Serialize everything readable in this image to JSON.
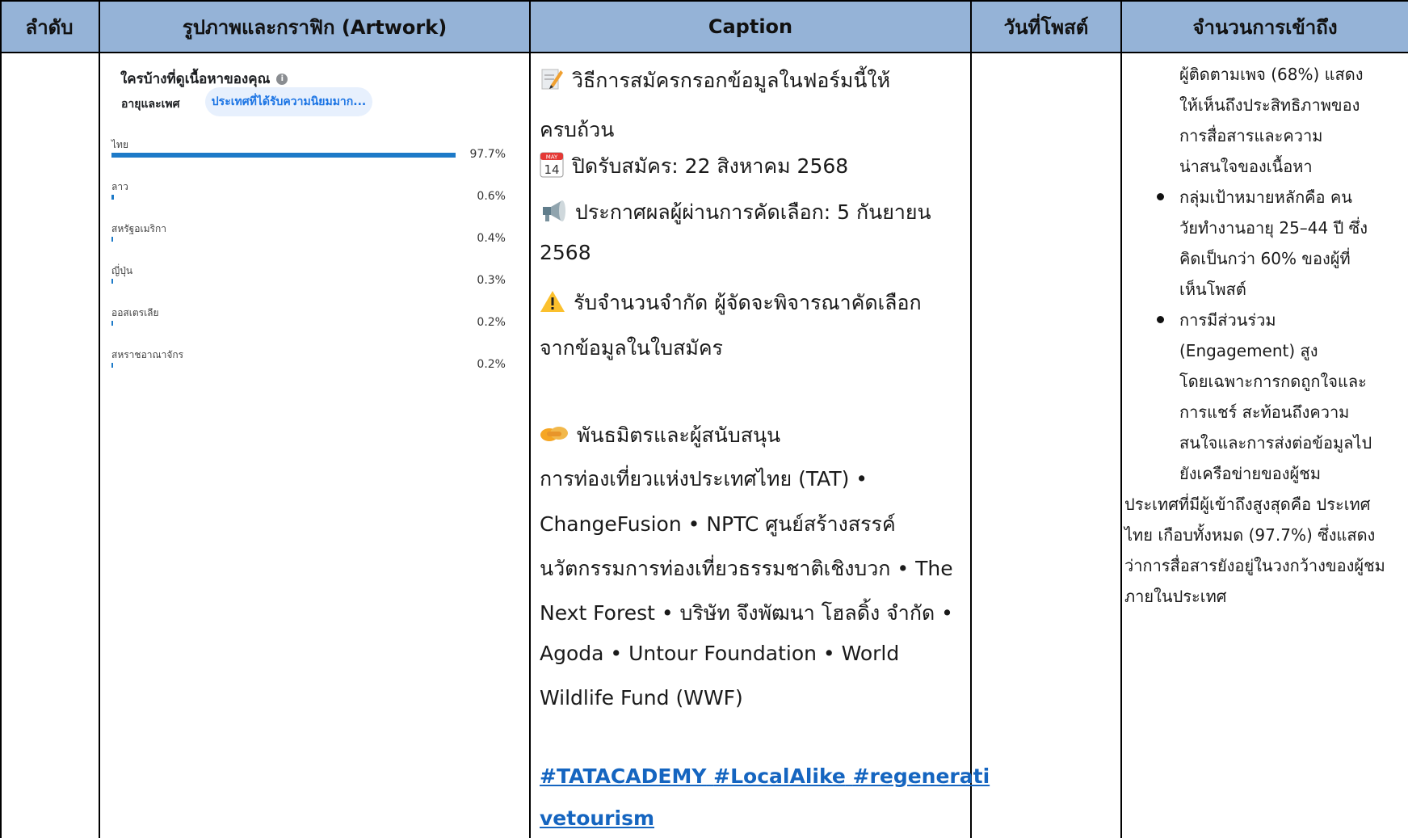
{
  "table": {
    "headers": {
      "no": "ลำดับ",
      "artwork": "รูปภาพและกราฟิก (Artwork)",
      "caption": "Caption",
      "date": "วันที่โพสต์",
      "reach": "จำนวนการเข้าถึง"
    }
  },
  "artwork": {
    "title": "ใครบ้างที่ดูเนื้อหาของคุณ",
    "tab_age": "อายุและเพศ",
    "tab_country": "ประเทศที่ได้รับความนิยมมาก...",
    "rows": [
      {
        "name": "ไทย",
        "pct": "97.7%",
        "value": 97.7
      },
      {
        "name": "ลาว",
        "pct": "0.6%",
        "value": 0.6
      },
      {
        "name": "สหรัฐอเมริกา",
        "pct": "0.4%",
        "value": 0.4
      },
      {
        "name": "ญี่ปุ่น",
        "pct": "0.3%",
        "value": 0.3
      },
      {
        "name": "ออสเตรเลีย",
        "pct": "0.2%",
        "value": 0.2
      },
      {
        "name": "สหราชอาณาจักร",
        "pct": "0.2%",
        "value": 0.2
      }
    ]
  },
  "caption": {
    "l1": "วิธีการสมัครกรอกข้อมูลในฟอร์มนี้ให้",
    "l2": "ครบถ้วน",
    "calendar_month": "MAY",
    "calendar_day": "14",
    "l3": "ปิดรับสมัคร: 22 สิงหาคม 2568",
    "l4": "ประกาศผลผู้ผ่านการคัดเลือก: 5 กันยายน",
    "l5": "2568",
    "l6": "รับจำนวนจำกัด ผู้จัดจะพิจารณาคัดเลือก",
    "l7": "จากข้อมูลในใบสมัคร",
    "l8": "พันธมิตรและผู้สนับสนุน",
    "l9": "การท่องเที่ยวแห่งประเทศไทย (TAT) •",
    "l10": "ChangeFusion • NPTC ศูนย์สร้างสรรค์",
    "l11": "นวัตกรรมการท่องเที่ยวธรรมชาติเชิงบวก • The",
    "l12": "Next Forest • บริษัท จึงพัฒนา โฮลดิ้ง จำกัด •",
    "l13": "Agoda • Untour Foundation • World",
    "l14": "Wildlife Fund (WWF)",
    "tag1": "#TATACADEMY",
    "tag2": "#LocalAlike",
    "tag3": "#regenerati",
    "tag4": "vetourism"
  },
  "reach": {
    "r1": "ผู้ติดตามเพจ (68%) แสดง",
    "r2": "ให้เห็นถึงประสิทธิภาพของ",
    "r3": "การสื่อสารและความ",
    "r4": "น่าสนใจของเนื้อหา",
    "r5": "กลุ่มเป้าหมายหลักคือ คน",
    "r6": "วัยทำงานอายุ 25–44 ปี ซึ่ง",
    "r7": "คิดเป็นกว่า 60% ของผู้ที่",
    "r8": "เห็นโพสต์",
    "r9": "การมีส่วนร่วม",
    "r10": "(Engagement) สูง",
    "r11": "โดยเฉพาะการกดถูกใจและ",
    "r12": "การแชร์ สะท้อนถึงความ",
    "r13": "สนใจและการส่งต่อข้อมูลไป",
    "r14": "ยังเครือข่ายของผู้ชม",
    "r15": "ประเทศที่มีผู้เข้าถึงสูงสุดคือ ประเทศ",
    "r16": "ไทย เกือบทั้งหมด (97.7%) ซึ่งแสดง",
    "r17": "ว่าการสื่อสารยังอยู่ในวงกว้างของผู้ชม",
    "r18": "ภายในประเทศ"
  }
}
